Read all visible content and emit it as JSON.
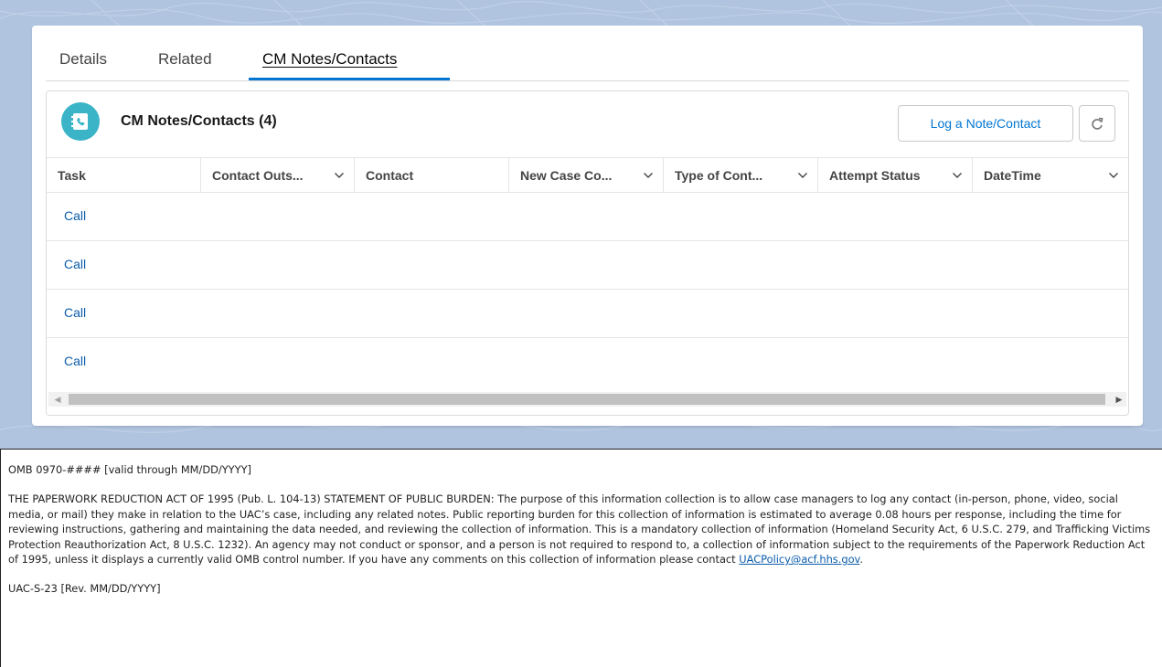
{
  "tabs": [
    {
      "label": "Details"
    },
    {
      "label": "Related"
    },
    {
      "label": "CM Notes/Contacts"
    }
  ],
  "related_list": {
    "title": "CM Notes/Contacts (4)",
    "icon": "phone-contact-icon",
    "log_button_label": "Log a Note/Contact",
    "refresh_icon": "refresh-icon",
    "columns": [
      {
        "label": "Task"
      },
      {
        "label": "Contact Outs..."
      },
      {
        "label": "Contact"
      },
      {
        "label": "New Case Co..."
      },
      {
        "label": "Type of Cont..."
      },
      {
        "label": "Attempt Status"
      },
      {
        "label": "DateTime"
      }
    ],
    "rows": [
      {
        "task": "Call"
      },
      {
        "task": "Call"
      },
      {
        "task": "Call"
      },
      {
        "task": "Call"
      }
    ]
  },
  "footer": {
    "omb": "OMB 0970-#### [valid through MM/DD/YYYY]",
    "statement": "THE PAPERWORK REDUCTION ACT OF 1995 (Pub. L. 104-13) STATEMENT OF PUBLIC BURDEN: The purpose of this information collection is to allow case managers to log any contact (in-person, phone, video, social media, or mail) they make in relation to the UAC’s case, including any related notes. Public reporting burden for this collection of information is estimated to average 0.08 hours per response, including the time for reviewing instructions, gathering and maintaining the data needed, and reviewing the collection of information. This is a mandatory collection of information (Homeland Security Act, 6 U.S.C. 279, and Trafficking Victims Protection Reauthorization Act, 8 U.S.C. 1232). An agency may not conduct or sponsor, and a person is not required to respond to, a collection of information subject to the requirements of the Paperwork Reduction Act of 1995, unless it displays a currently valid OMB control number. If you have any comments on this collection of information please contact ",
    "email": "UACPolicy@acf.hhs.gov",
    "statement_end": ".",
    "form_id": "UAC-S-23 [Rev. MM/DD/YYYY]"
  },
  "colors": {
    "accent": "#0176d3",
    "link": "#0b5cab",
    "icon_bg": "#3bb4c8",
    "page_bg": "#b0c4df"
  }
}
